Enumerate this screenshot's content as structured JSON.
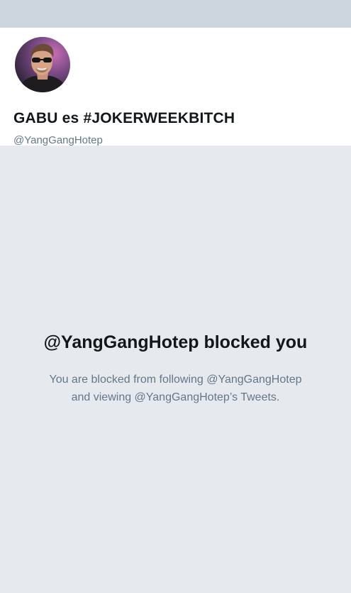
{
  "profile": {
    "display_name": "GABU es #JOKERWEEKBITCH",
    "handle": "@YangGangHotep",
    "avatar_icon": "profile-photo",
    "banner_color": "#cdd5de"
  },
  "blocked": {
    "title": "@YangGangHotep blocked you",
    "line1": "You are blocked from following @YangGangHotep",
    "line2": "and viewing @YangGangHotep’s Tweets."
  },
  "colors": {
    "background": "#e6eaee",
    "primary_text": "#14171a",
    "secondary_text": "#657786"
  }
}
